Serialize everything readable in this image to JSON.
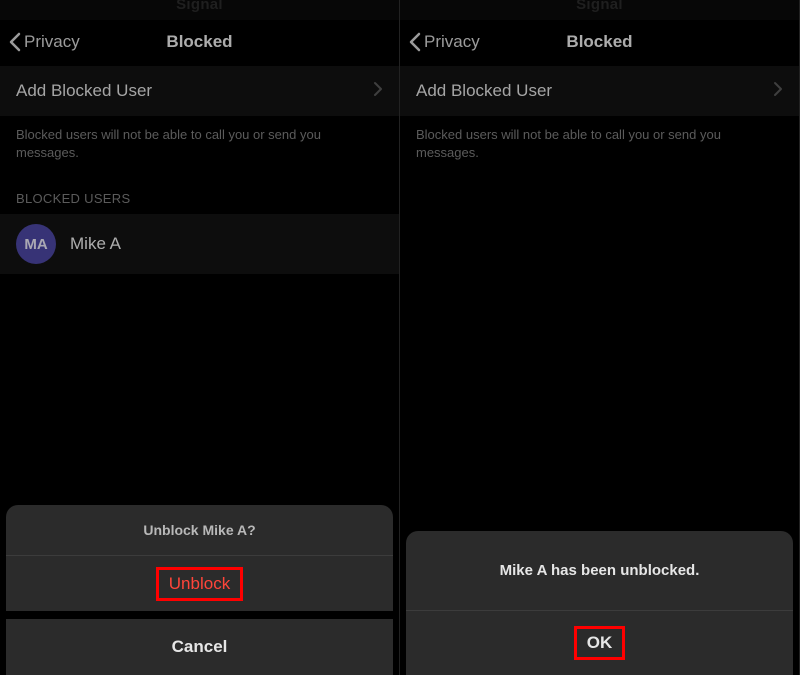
{
  "left": {
    "app_name": "Signal",
    "nav": {
      "back_label": "Privacy",
      "title": "Blocked"
    },
    "add_cell": {
      "label": "Add Blocked User"
    },
    "footer": "Blocked users will not be able to call you or send you messages.",
    "section_header": "BLOCKED USERS",
    "user": {
      "initials": "MA",
      "name": "Mike A"
    },
    "sheet": {
      "title": "Unblock Mike A?",
      "unblock": "Unblock",
      "cancel": "Cancel"
    }
  },
  "right": {
    "app_name": "Signal",
    "nav": {
      "back_label": "Privacy",
      "title": "Blocked"
    },
    "add_cell": {
      "label": "Add Blocked User"
    },
    "footer": "Blocked users will not be able to call you or send you messages.",
    "alert": {
      "message": "Mike A has been unblocked.",
      "ok": "OK"
    }
  }
}
